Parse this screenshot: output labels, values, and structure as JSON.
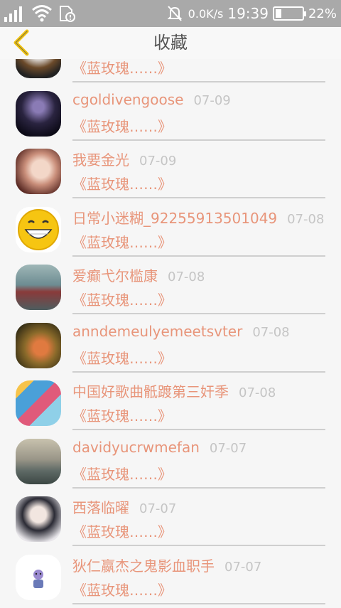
{
  "status_bar": {
    "net_speed": "0.0K/s",
    "time": "19:39",
    "battery": "22%",
    "battery_level": 0.22
  },
  "header": {
    "title": "收藏"
  },
  "favorites": [
    {
      "name": "",
      "date": "",
      "work": "《蓝玫瑰……》"
    },
    {
      "name": "cgoldivengoose",
      "date": "07-09",
      "work": "《蓝玫瑰……》"
    },
    {
      "name": "我要金光",
      "date": "07-09",
      "work": "《蓝玫瑰……》"
    },
    {
      "name": "日常小迷糊_92255913501049",
      "date": "07-08",
      "work": "《蓝玫瑰……》"
    },
    {
      "name": "爱癫弋尔槛康",
      "date": "07-08",
      "work": "《蓝玫瑰……》"
    },
    {
      "name": "anndemeulyemeetsvter",
      "date": "07-08",
      "work": "《蓝玫瑰……》"
    },
    {
      "name": "中国好歌曲骶踱第三奸季",
      "date": "07-08",
      "work": "《蓝玫瑰……》"
    },
    {
      "name": "davidyucrwmefan",
      "date": "07-07",
      "work": "《蓝玫瑰……》"
    },
    {
      "name": "西落临曜",
      "date": "07-07",
      "work": "《蓝玫瑰……》"
    },
    {
      "name": "狄仁嬴杰之鬼影血职手",
      "date": "07-07",
      "work": "《蓝玫瑰……》"
    }
  ],
  "colors": {
    "status_bar": "#a9a9a9",
    "accent_text": "#e8957a",
    "date_text": "#c5c5c5",
    "back_arrow": "#f1c40f"
  }
}
